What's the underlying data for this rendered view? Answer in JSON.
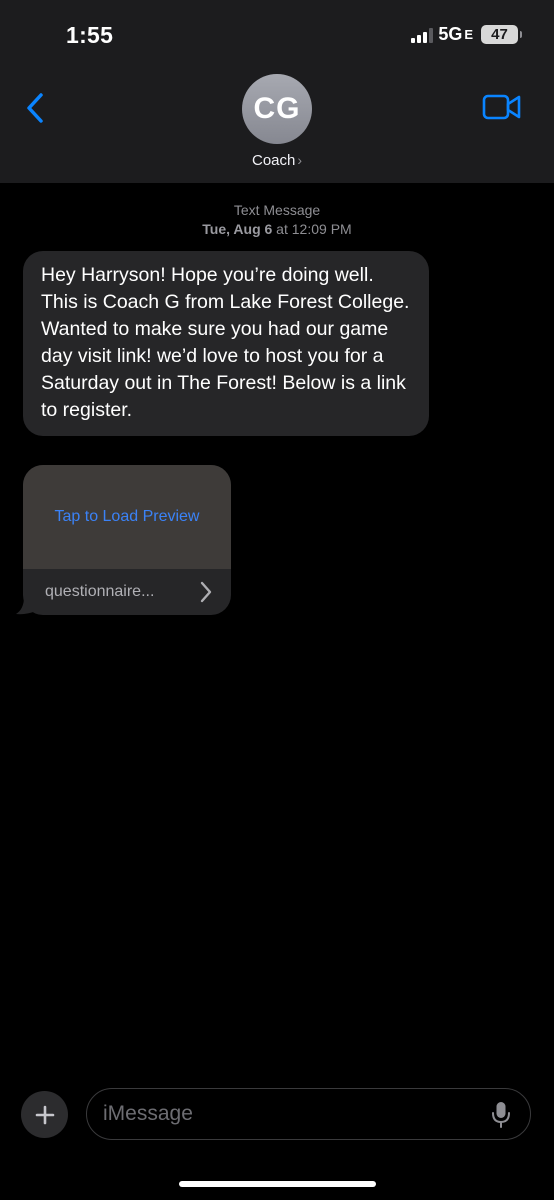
{
  "status": {
    "time": "1:55",
    "network": "5G",
    "network_suffix": "E",
    "battery": "47"
  },
  "header": {
    "avatar_initials": "CG",
    "contact_name": "Coach",
    "contact_chevron": "›",
    "back_icon": "chevron-left-icon",
    "video_icon": "video-camera-icon"
  },
  "thread": {
    "timestamp_label": "Text Message",
    "timestamp_day": "Tue, Aug 6",
    "timestamp_at": " at ",
    "timestamp_time": "12:09 PM",
    "message_text": "Hey Harryson! Hope you’re doing well. This is Coach G from Lake Forest College. Wanted to make sure you had our game day visit link! we’d love to host you for a Saturday out in The Forest! Below is a link to register.",
    "link_preview": {
      "cta": "Tap to Load Preview",
      "url_text": "questionnaire..."
    }
  },
  "composer": {
    "placeholder": "iMessage"
  },
  "colors": {
    "accent": "#0a84ff",
    "bubble": "#262628",
    "header_bg": "#1c1c1e"
  }
}
